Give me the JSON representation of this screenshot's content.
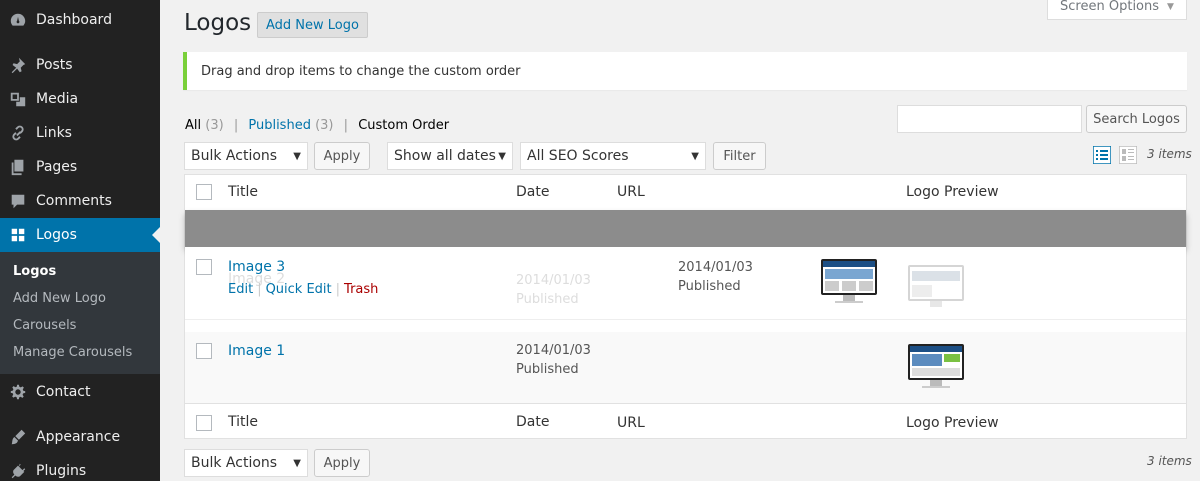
{
  "sidebar": {
    "items": [
      {
        "label": "Dashboard",
        "icon": "dashboard-icon"
      },
      {
        "label": "Posts",
        "icon": "pin-icon"
      },
      {
        "label": "Media",
        "icon": "media-icon"
      },
      {
        "label": "Links",
        "icon": "link-icon"
      },
      {
        "label": "Pages",
        "icon": "pages-icon"
      },
      {
        "label": "Comments",
        "icon": "comment-icon"
      },
      {
        "label": "Logos",
        "icon": "grid-icon"
      },
      {
        "label": "Contact",
        "icon": "gear-icon"
      },
      {
        "label": "Appearance",
        "icon": "brush-icon"
      },
      {
        "label": "Plugins",
        "icon": "plug-icon"
      }
    ],
    "submenu": [
      "Logos",
      "Add New Logo",
      "Carousels",
      "Manage Carousels"
    ]
  },
  "header": {
    "screen_options": "Screen Options",
    "title": "Logos",
    "add_new": "Add New Logo"
  },
  "notice": "Drag and drop items to change the custom order",
  "filters": {
    "all": "All",
    "all_count": "(3)",
    "published": "Published",
    "published_count": "(3)",
    "custom_order": "Custom Order",
    "sep": "|"
  },
  "search": {
    "button": "Search Logos",
    "value": ""
  },
  "toolbar": {
    "bulk_actions": "Bulk Actions",
    "apply": "Apply",
    "dates": "Show all dates",
    "seo": "All SEO Scores",
    "filter": "Filter",
    "items_count": "3 items"
  },
  "table": {
    "columns": [
      "Title",
      "Date",
      "URL",
      "Logo Preview"
    ],
    "rows": [
      {
        "title": "Image 3",
        "ghost_title": "Image 2",
        "actions": [
          "Edit",
          "Quick Edit",
          "Trash"
        ],
        "date": "2014/01/03",
        "status": "Published",
        "ghost_date": "2014/01/03",
        "ghost_status": "Published"
      },
      {
        "title": "Image 1",
        "date": "2014/01/03",
        "status": "Published"
      }
    ]
  },
  "colors": {
    "accent": "#0073aa",
    "sidebar": "#222222",
    "notice": "#7ad03a",
    "drag_placeholder": "#8c8c8c"
  }
}
